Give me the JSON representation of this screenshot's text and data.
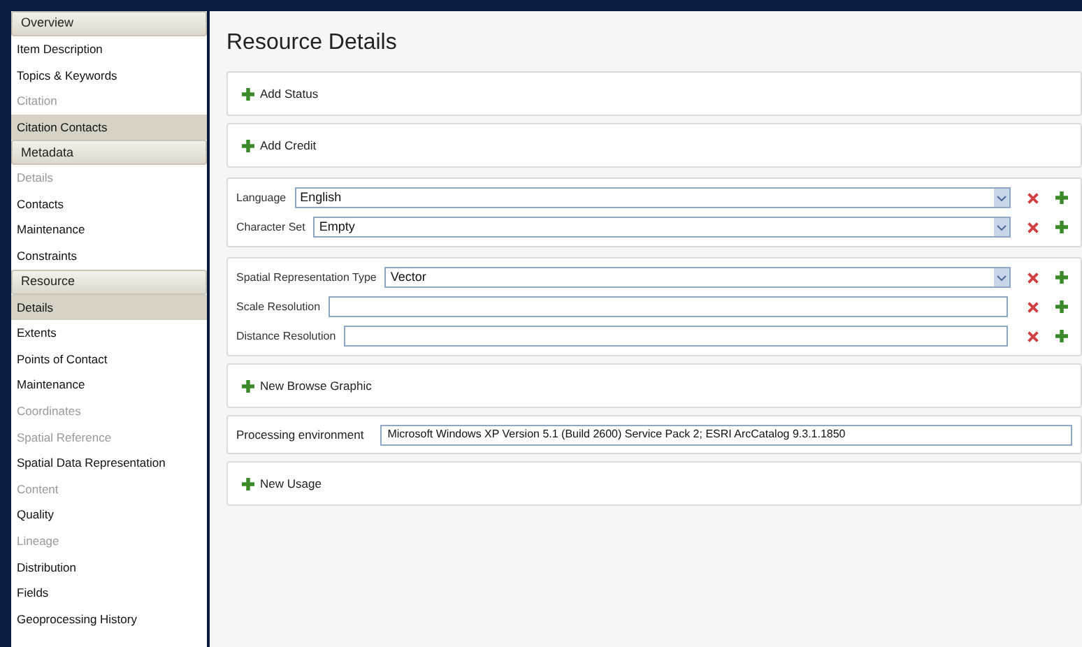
{
  "sidebar": {
    "sections": [
      {
        "title": "Overview",
        "items": [
          {
            "label": "Item Description",
            "selected": false,
            "disabled": false
          },
          {
            "label": "Topics & Keywords",
            "selected": false,
            "disabled": false
          },
          {
            "label": "Citation",
            "selected": false,
            "disabled": true
          },
          {
            "label": "Citation Contacts",
            "selected": true,
            "disabled": false
          }
        ]
      },
      {
        "title": "Metadata",
        "items": [
          {
            "label": "Details",
            "selected": false,
            "disabled": true
          },
          {
            "label": "Contacts",
            "selected": false,
            "disabled": false
          },
          {
            "label": "Maintenance",
            "selected": false,
            "disabled": false
          },
          {
            "label": "Constraints",
            "selected": false,
            "disabled": false
          }
        ]
      },
      {
        "title": "Resource",
        "items": [
          {
            "label": "Details",
            "selected": true,
            "disabled": false
          },
          {
            "label": "Extents",
            "selected": false,
            "disabled": false
          },
          {
            "label": "Points of Contact",
            "selected": false,
            "disabled": false
          },
          {
            "label": "Maintenance",
            "selected": false,
            "disabled": false
          },
          {
            "label": "Coordinates",
            "selected": false,
            "disabled": true
          },
          {
            "label": "Spatial Reference",
            "selected": false,
            "disabled": true
          },
          {
            "label": "Spatial Data Representation",
            "selected": false,
            "disabled": false
          },
          {
            "label": "Content",
            "selected": false,
            "disabled": true
          },
          {
            "label": "Quality",
            "selected": false,
            "disabled": false
          },
          {
            "label": "Lineage",
            "selected": false,
            "disabled": true
          },
          {
            "label": "Distribution",
            "selected": false,
            "disabled": false
          },
          {
            "label": "Fields",
            "selected": false,
            "disabled": false
          },
          {
            "label": "Geoprocessing History",
            "selected": false,
            "disabled": false
          }
        ]
      }
    ]
  },
  "title": "Resource Details",
  "cards": [
    {
      "kind": "add",
      "label": "Add Status"
    },
    {
      "kind": "add",
      "label": "Add Credit"
    },
    {
      "kind": "fields",
      "rows": [
        {
          "label": "Language",
          "value": "English",
          "kind": "select"
        },
        {
          "label": "Character Set",
          "value": "Empty",
          "kind": "select"
        }
      ]
    },
    {
      "kind": "fields",
      "rows": [
        {
          "label": "Spatial Representation Type",
          "value": "Vector",
          "kind": "select"
        },
        {
          "label": "Scale Resolution",
          "kind": "text"
        },
        {
          "label": "Distance Resolution",
          "kind": "text"
        }
      ]
    },
    {
      "kind": "add",
      "label": "New Browse Graphic"
    },
    {
      "kind": "field",
      "label": "Processing environment",
      "value": "Microsoft Windows XP Version 5.1 (Build 2600) Service Pack 2; ESRI ArcCatalog 9.3.1.1850"
    },
    {
      "kind": "add",
      "label": "New Usage"
    }
  ]
}
